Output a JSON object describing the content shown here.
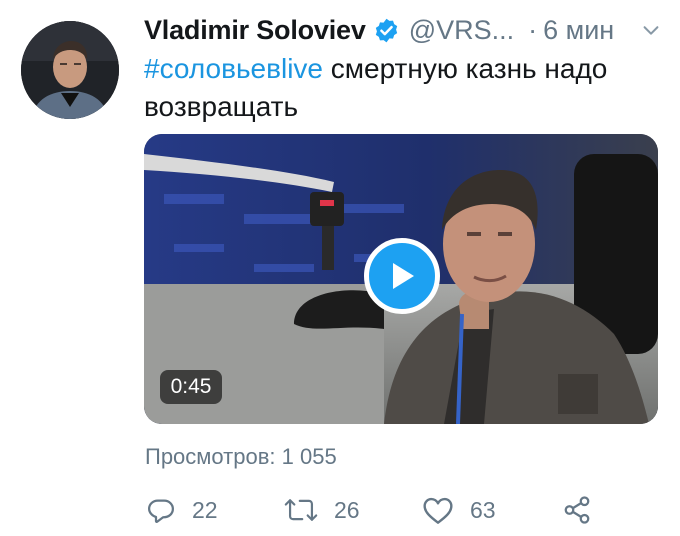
{
  "tweet": {
    "author_name": "Vladimir Soloviev",
    "handle": "@VRS...",
    "separator": "·",
    "time": "6 мин",
    "hashtag": "#соловьевlive",
    "text": " смертную казнь надо возвращать",
    "video_duration": "0:45",
    "views": "Просмотров: 1 055"
  },
  "actions": {
    "replies": "22",
    "retweets": "26",
    "likes": "63"
  },
  "icons": {
    "verified": "verified-badge-icon",
    "chevron": "chevron-down-icon",
    "play": "play-icon",
    "reply": "reply-icon",
    "retweet": "retweet-icon",
    "like": "heart-icon",
    "share": "share-icon"
  },
  "colors": {
    "accent": "#1da1f2",
    "link": "#1b95e0",
    "secondary_text": "#657786",
    "primary_text": "#14171a"
  }
}
